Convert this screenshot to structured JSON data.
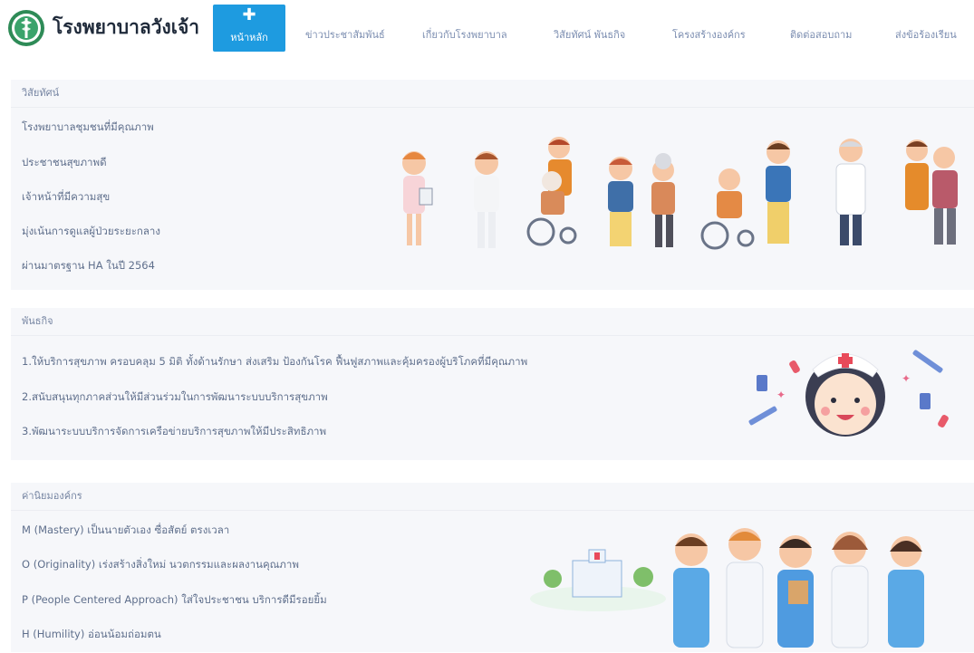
{
  "header": {
    "site_title": "โรงพยาบาลวังเจ้า",
    "home": {
      "label": "หน้าหลัก",
      "icon": "plus-icon"
    },
    "nav": [
      "ข่าวประชาสัมพันธ์",
      "เกี่ยวกับโรงพยาบาล",
      "วิสัยทัศน์ พันธกิจ",
      "โครงสร้างองค์กร",
      "ติดต่อสอบถาม",
      "ส่งข้อร้องเรียน"
    ],
    "accent_color": "#1e9be0"
  },
  "vision": {
    "title": "วิสัยทัศน์",
    "items": [
      "โรงพยาบาลชุมชนที่มีคุณภาพ",
      "ประชาชนสุขภาพดี",
      "เจ้าหน้าที่มีความสุข",
      "มุ่งเน้นการดูแลผู้ป่วยระยะกลาง",
      "ผ่านมาตรฐาน HA ในปี 2564"
    ]
  },
  "mission": {
    "title": "พันธกิจ",
    "items": [
      "1.ให้บริการสุขภาพ ครอบคลุม 5 มิติ ทั้งด้านรักษา ส่งเสริม ป้องกันโรค ฟื้นฟูสภาพและคุ้มครองผู้บริโภคที่มีคุณภาพ",
      "2.สนับสนุนทุกภาคส่วนให้มีส่วนร่วมในการพัฒนาระบบบริการสุขภาพ",
      "3.พัฒนาระบบบริการจัดการเครือข่ายบริการสุขภาพให้มีประสิทธิภาพ"
    ]
  },
  "values": {
    "title": "ค่านิยมองค์กร",
    "items": [
      "M (Mastery) เป็นนายตัวเอง ซื่อสัตย์ ตรงเวลา",
      "O (Originality) เร่งสร้างสิ่งใหม่ นวตกรรมและผลงานคุณภาพ",
      "P (People Centered Approach) ใส่ใจประชาชน บริการดีมีรอยยิ้ม",
      "H (Humility) อ่อนน้อมถ่อมตน"
    ]
  }
}
